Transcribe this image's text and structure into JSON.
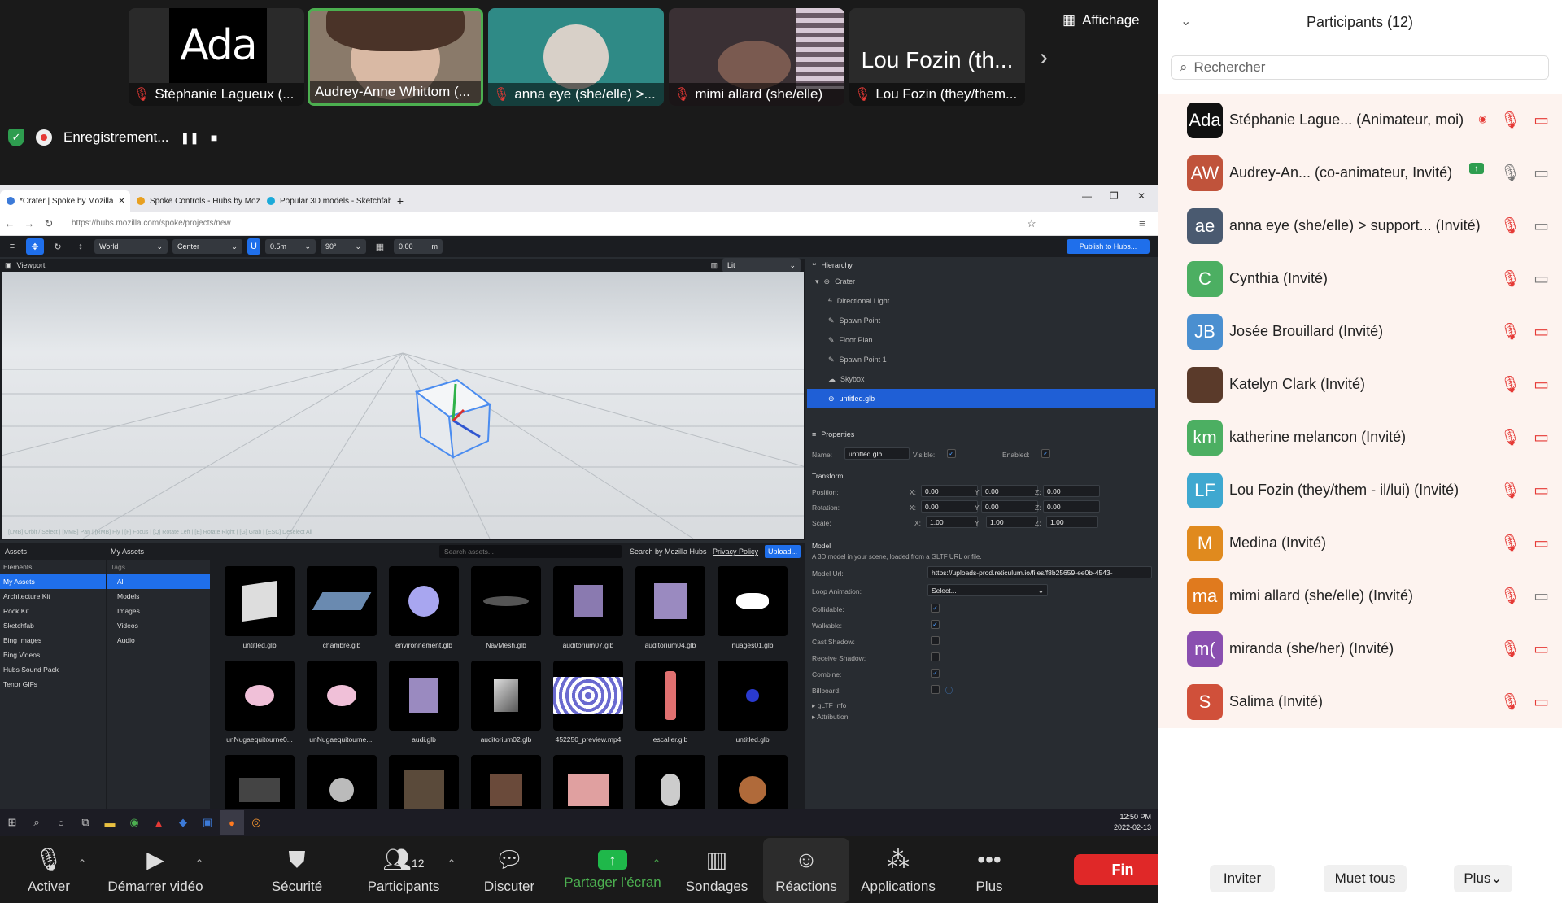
{
  "video_strip": {
    "tiles": [
      {
        "name": "Stéphanie Lagueux (...",
        "logo_text": "Ada"
      },
      {
        "name": "Audrey-Anne Whittom (..."
      },
      {
        "name": "anna eye (she/elle) >..."
      },
      {
        "name": "mimi allard (she/elle)"
      },
      {
        "name": "Lou Fozin (they/them...",
        "big_name": "Lou Fozin (th..."
      }
    ],
    "view_label": "Affichage",
    "recording_label": "Enregistrement..."
  },
  "browser": {
    "tabs": [
      {
        "label": "*Crater | Spoke by Mozilla"
      },
      {
        "label": "Spoke Controls - Hubs by Mozilla"
      },
      {
        "label": "Popular 3D models - Sketchfab"
      }
    ],
    "url": "https://hubs.mozilla.com/spoke/projects/new"
  },
  "spoke": {
    "toolbar": {
      "space": "World",
      "pivot": "Center",
      "snap": "0.5m",
      "rotate_snap": "90°",
      "grid": "0.00",
      "grid_unit": "m",
      "publish": "Publish to Hubs..."
    },
    "viewport": {
      "title": "Viewport",
      "render_mode": "Lit",
      "hint": "[LMB] Orbit / Select | [MMB] Pan | [RMB] Fly | [F] Focus | [Q] Rotate Left | [E] Rotate Right | [G] Grab | [ESC] Deselect All"
    },
    "hierarchy": {
      "title": "Hierarchy",
      "items": [
        "Crater",
        "Directional Light",
        "Spawn Point",
        "Floor Plan",
        "Spawn Point 1",
        "Skybox",
        "untitled.glb"
      ]
    },
    "properties": {
      "title": "Properties",
      "name_label": "Name:",
      "name_value": "untitled.glb",
      "visible_label": "Visible:",
      "enabled_label": "Enabled:",
      "transform_label": "Transform",
      "position_label": "Position:",
      "rotation_label": "Rotation:",
      "scale_label": "Scale:",
      "position": [
        "0.00",
        "0.00",
        "0.00"
      ],
      "rotation": [
        "0.00",
        "0.00",
        "0.00"
      ],
      "scale": [
        "1.00",
        "1.00",
        "1.00"
      ],
      "axis_x": "X:",
      "axis_y": "Y:",
      "axis_z": "Z:",
      "model_label": "Model",
      "model_desc": "A 3D model in your scene, loaded from a GLTF URL or file.",
      "model_url_label": "Model Url:",
      "model_url": "https://uploads-prod.reticulum.io/files/f8b25659-ee0b-4543-",
      "loop_label": "Loop Animation:",
      "loop_value": "Select...",
      "collidable": "Collidable:",
      "walkable": "Walkable:",
      "cast_shadow": "Cast Shadow:",
      "receive_shadow": "Receive Shadow:",
      "combine": "Combine:",
      "billboard": "Billboard:",
      "gltf_info": "gLTF Info",
      "attribution": "Attribution"
    },
    "assets": {
      "title": "Assets",
      "section": "My Assets",
      "search_placeholder": "Search assets...",
      "search_by": "Search by Mozilla Hubs",
      "privacy": "Privacy Policy",
      "upload": "Upload...",
      "sources_header": "Elements",
      "sources": [
        "My Assets",
        "Architecture Kit",
        "Rock Kit",
        "Sketchfab",
        "Bing Images",
        "Bing Videos",
        "Hubs Sound Pack",
        "Tenor GIFs"
      ],
      "tags_header": "Tags",
      "tags": [
        "All",
        "Models",
        "Images",
        "Videos",
        "Audio"
      ],
      "items": [
        "untitled.glb",
        "chambre.glb",
        "environnement.glb",
        "NavMesh.glb",
        "auditorium07.glb",
        "auditorium04.glb",
        "nuages01.glb",
        "unNugaequitourne0...",
        "unNugaequitourne....",
        "audi.glb",
        "auditorium02.glb",
        "452250_preview.mp4",
        "escalier.glb",
        "untitled.glb"
      ]
    }
  },
  "taskbar": {
    "time": "12:50 PM",
    "date": "2022-02-13"
  },
  "zoom_toolbar": {
    "mute": "Activer",
    "video": "Démarrer vidéo",
    "security": "Sécurité",
    "participants": "Participants",
    "participants_count": "12",
    "chat": "Discuter",
    "share": "Partager l'écran",
    "polls": "Sondages",
    "reactions": "Réactions",
    "apps": "Applications",
    "more": "Plus",
    "end": "Fin"
  },
  "participants_panel": {
    "title": "Participants (12)",
    "search_placeholder": "Rechercher",
    "list": [
      {
        "initials": "Ada",
        "name": "Stéphanie Lague...  (Animateur, moi)",
        "color": "#111111"
      },
      {
        "initials": "AW",
        "name": "Audrey-An...   (co-animateur, Invité)",
        "color": "#c0533b"
      },
      {
        "initials": "ae",
        "name": "anna eye (she/elle) > support...   (Invité)",
        "color": "#4a5a70"
      },
      {
        "initials": "C",
        "name": "Cynthia (Invité)",
        "color": "#4caf62"
      },
      {
        "initials": "JB",
        "name": "Josée Brouillard (Invité)",
        "color": "#4a8fd0"
      },
      {
        "initials": "",
        "name": "Katelyn Clark (Invité)",
        "color": "#5a3a2a"
      },
      {
        "initials": "km",
        "name": "katherine melancon (Invité)",
        "color": "#4caf62"
      },
      {
        "initials": "LF",
        "name": "Lou Fozin (they/them - il/lui) (Invité)",
        "color": "#3fa8d0"
      },
      {
        "initials": "M",
        "name": "Medina (Invité)",
        "color": "#e08a1e"
      },
      {
        "initials": "ma",
        "name": "mimi allard (she/elle) (Invité)",
        "color": "#e07a1e"
      },
      {
        "initials": "m(",
        "name": "miranda (she/her) (Invité)",
        "color": "#8a4fb0"
      },
      {
        "initials": "S",
        "name": "Salima (Invité)",
        "color": "#d0503a"
      }
    ],
    "invite": "Inviter",
    "mute_all": "Muet tous",
    "more": "Plus"
  }
}
